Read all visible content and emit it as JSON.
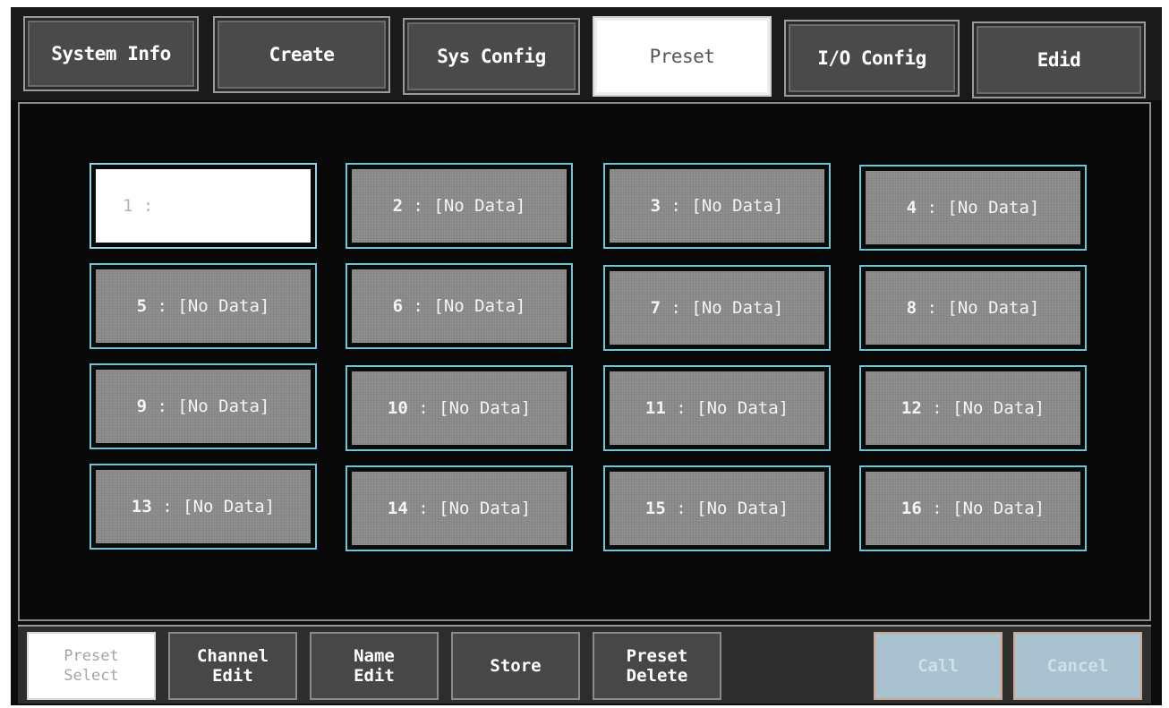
{
  "tabs": [
    {
      "label": "System Info",
      "active": false
    },
    {
      "label": "Create",
      "active": false
    },
    {
      "label": "Sys Config",
      "active": false
    },
    {
      "label": "Preset",
      "active": true
    },
    {
      "label": "I/O Config",
      "active": false
    },
    {
      "label": "Edid",
      "active": false
    }
  ],
  "presets": [
    {
      "num": "1",
      "name": "",
      "selected": true
    },
    {
      "num": "2",
      "name": "[No Data]"
    },
    {
      "num": "3",
      "name": "[No Data]"
    },
    {
      "num": "4",
      "name": "[No Data]"
    },
    {
      "num": "5",
      "name": "[No Data]"
    },
    {
      "num": "6",
      "name": "[No Data]"
    },
    {
      "num": "7",
      "name": "[No Data]"
    },
    {
      "num": "8",
      "name": "[No Data]"
    },
    {
      "num": "9",
      "name": "[No Data]"
    },
    {
      "num": "10",
      "name": "[No Data]"
    },
    {
      "num": "11",
      "name": "[No Data]"
    },
    {
      "num": "12",
      "name": "[No Data]"
    },
    {
      "num": "13",
      "name": "[No Data]"
    },
    {
      "num": "14",
      "name": "[No Data]"
    },
    {
      "num": "15",
      "name": "[No Data]"
    },
    {
      "num": "16",
      "name": "[No Data]"
    }
  ],
  "separator": " : ",
  "bottom": {
    "preset_select": {
      "line1": "Preset",
      "line2": "Select"
    },
    "channel_edit": {
      "line1": "Channel",
      "line2": "Edit"
    },
    "name_edit": {
      "line1": "Name",
      "line2": "Edit"
    },
    "store": {
      "line1": "Store"
    },
    "preset_delete": {
      "line1": "Preset",
      "line2": "Delete"
    },
    "call": {
      "line1": "Call"
    },
    "cancel": {
      "line1": "Cancel"
    }
  },
  "colors": {
    "accent_border": "#6cc6d4",
    "button_face": "#8a8b8a",
    "disabled_button": "#a8c2cf"
  }
}
